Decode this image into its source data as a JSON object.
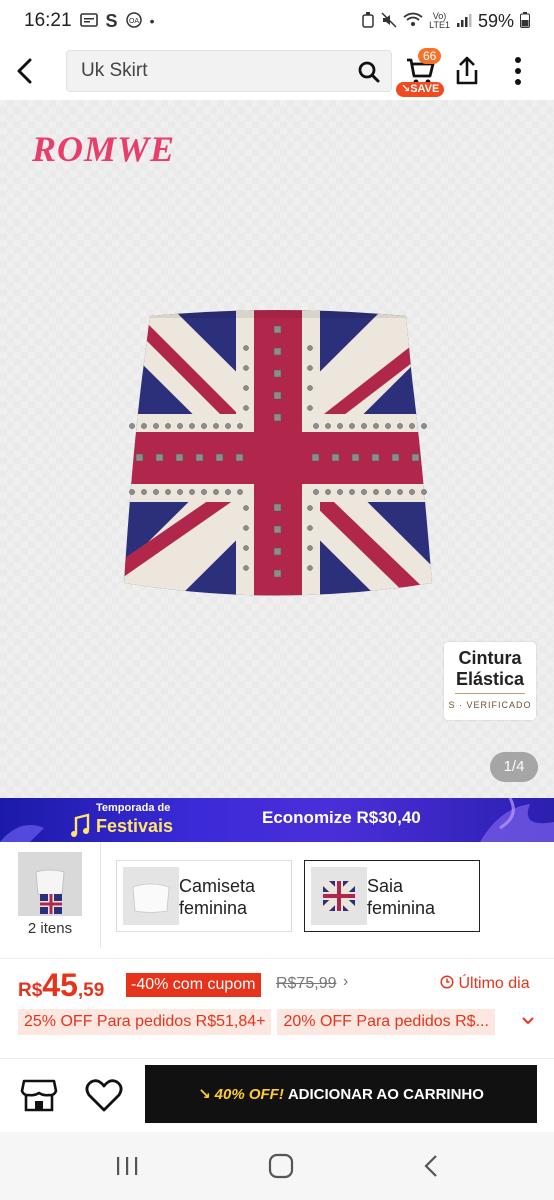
{
  "status_bar": {
    "time": "16:21",
    "battery": "59%"
  },
  "topbar": {
    "search_value": "Uk Skirt",
    "cart_count": "66",
    "save_label": "SAVE"
  },
  "hero": {
    "brand": "ROMWE",
    "badge_line1": "Cintura",
    "badge_line2": "Elástica",
    "badge_verified": "S · VERIFICADO",
    "page_indicator": "1/4"
  },
  "promo": {
    "line1": "Temporada de",
    "line2": "Festivais",
    "savings": "Economize R$30,40"
  },
  "bundle": {
    "count_label": "2 itens",
    "items": [
      {
        "label_line1": "Camiseta",
        "label_line2": "feminina"
      },
      {
        "label_line1": "Saia",
        "label_line2": "feminina"
      }
    ]
  },
  "pricing": {
    "currency": "R$",
    "price_int": "45",
    "price_dec": ",59",
    "coupon": "-40% com cupom",
    "old_price": "R$75,99",
    "last_day": "Último dia",
    "offers": [
      "25% OFF Para pedidos R$51,84+",
      "20% OFF Para pedidos R$..."
    ]
  },
  "actions": {
    "discount": "40% OFF!",
    "add_to_cart": "ADICIONAR AO CARRINHO"
  },
  "colors": {
    "accent": "#e8331c",
    "brand": "#e83e6a",
    "flag_red": "#b1264b",
    "flag_blue": "#2c2f7a"
  }
}
